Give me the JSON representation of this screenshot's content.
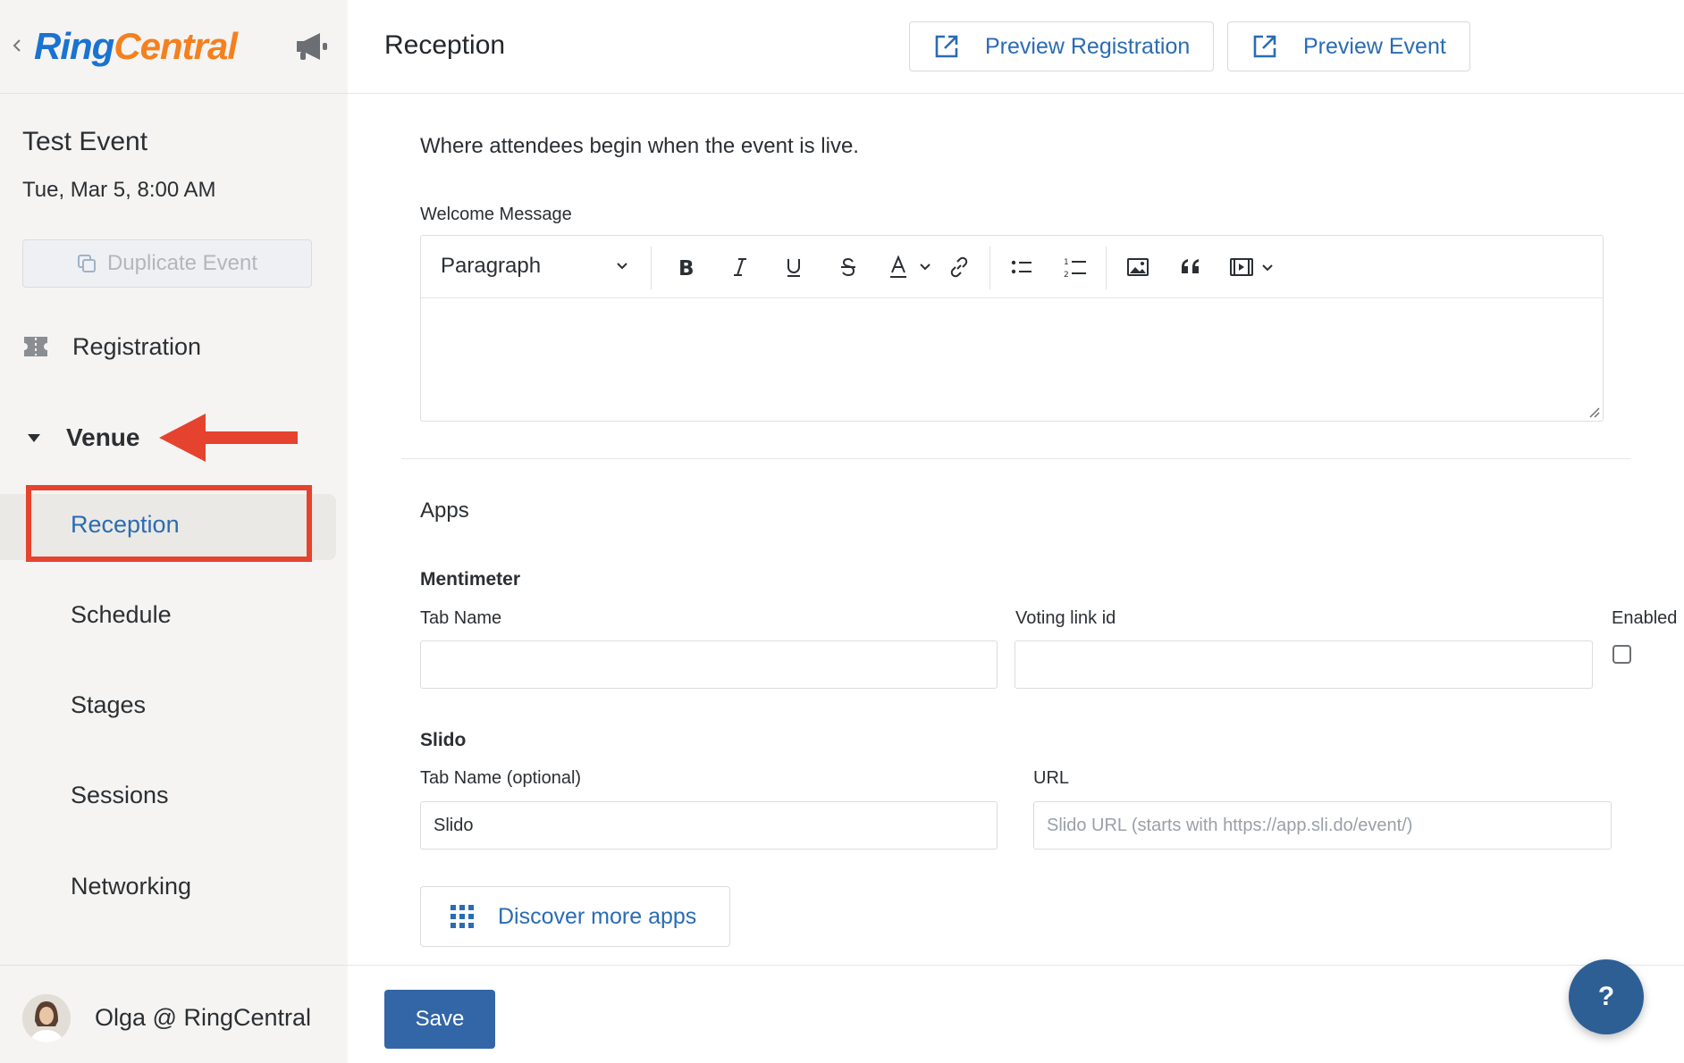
{
  "brand": {
    "logo_part1": "Ring",
    "logo_part2": "Central",
    "color_blue": "#1a73d1",
    "color_orange": "#f4801f"
  },
  "sidebar": {
    "event_title": "Test Event",
    "event_date": "Tue, Mar 5, 8:00 AM",
    "duplicate_label": "Duplicate Event",
    "registration_label": "Registration",
    "venue_label": "Venue",
    "venue_items": [
      {
        "label": "Reception",
        "active": true
      },
      {
        "label": "Schedule"
      },
      {
        "label": "Stages"
      },
      {
        "label": "Sessions"
      },
      {
        "label": "Networking"
      }
    ],
    "user_name": "Olga @ RingCentral"
  },
  "header": {
    "title": "Reception",
    "preview_registration": "Preview Registration",
    "preview_event": "Preview Event"
  },
  "content": {
    "description": "Where attendees begin when the event is live.",
    "welcome_label": "Welcome Message",
    "editor": {
      "block_format": "Paragraph"
    },
    "apps_title": "Apps",
    "mentimeter": {
      "title": "Mentimeter",
      "tab_name_label": "Tab Name",
      "tab_name_value": "",
      "voting_label": "Voting link id",
      "voting_value": "",
      "enabled_label": "Enabled",
      "enabled": false
    },
    "slido": {
      "title": "Slido",
      "tab_label": "Tab Name (optional)",
      "tab_value": "Slido",
      "url_label": "URL",
      "url_placeholder": "Slido URL (starts with https://app.sli.do/event/)"
    },
    "discover_label": "Discover more apps"
  },
  "footer": {
    "save_label": "Save",
    "help_label": "?"
  },
  "colors": {
    "accent": "#2a6cb3",
    "save_bg": "#3366a6",
    "annotation_red": "#e5432e"
  }
}
